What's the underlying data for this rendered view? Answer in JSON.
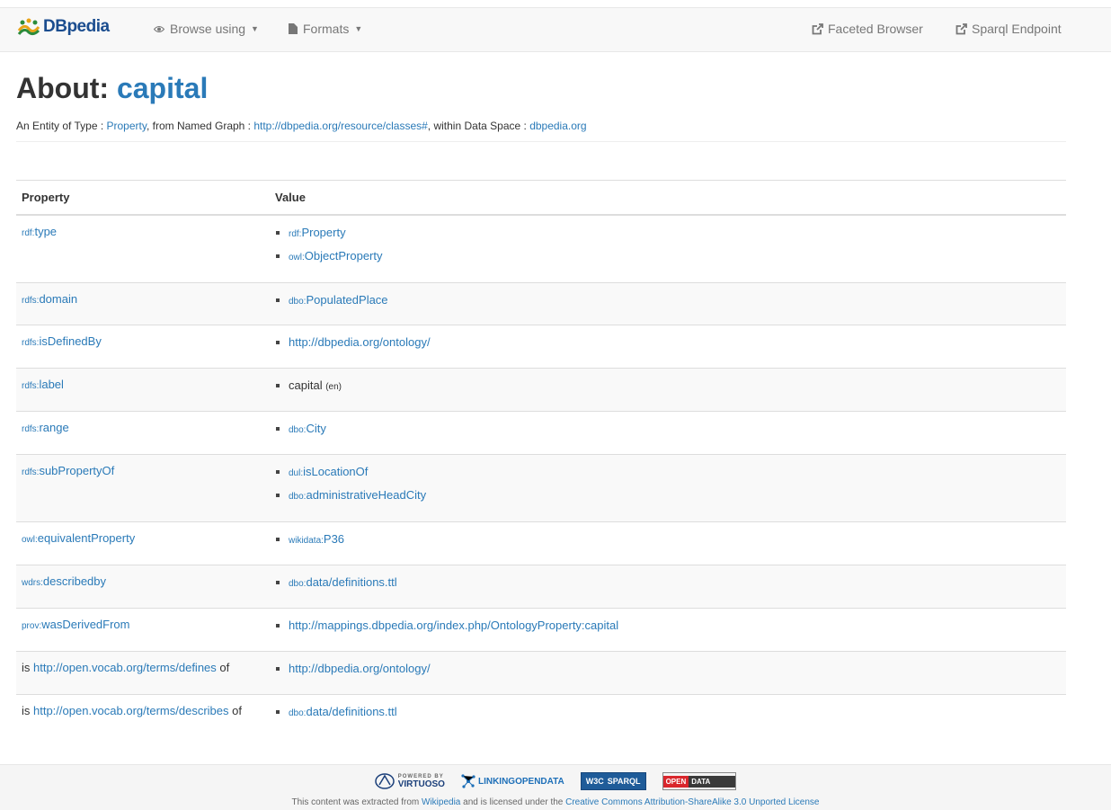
{
  "navbar": {
    "brand": "DBpedia",
    "browse_using": "Browse using",
    "formats": "Formats",
    "faceted_browser": "Faceted Browser",
    "sparql_endpoint": "Sparql Endpoint"
  },
  "page": {
    "about_label": "About:",
    "title": "capital",
    "subtitle": {
      "p1": "An Entity of Type : ",
      "type": "Property",
      "p2": ", from Named Graph : ",
      "graph": "http://dbpedia.org/resource/classes#",
      "p3": ", within Data Space : ",
      "space": "dbpedia.org"
    }
  },
  "table": {
    "header_property": "Property",
    "header_value": "Value",
    "rows": [
      {
        "prefix": "rdf:",
        "name": "type",
        "values": [
          {
            "prefix": "rdf:",
            "text": "Property"
          },
          {
            "prefix": "owl:",
            "text": "ObjectProperty"
          }
        ]
      },
      {
        "prefix": "rdfs:",
        "name": "domain",
        "values": [
          {
            "prefix": "dbo:",
            "text": "PopulatedPlace"
          }
        ]
      },
      {
        "prefix": "rdfs:",
        "name": "isDefinedBy",
        "values": [
          {
            "text": "http://dbpedia.org/ontology/"
          }
        ]
      },
      {
        "prefix": "rdfs:",
        "name": "label",
        "values": [
          {
            "text": "capital",
            "lang": "(en)"
          }
        ]
      },
      {
        "prefix": "rdfs:",
        "name": "range",
        "values": [
          {
            "prefix": "dbo:",
            "text": "City"
          }
        ]
      },
      {
        "prefix": "rdfs:",
        "name": "subPropertyOf",
        "values": [
          {
            "prefix": "dul:",
            "text": "isLocationOf"
          },
          {
            "prefix": "dbo:",
            "text": "administrativeHeadCity"
          }
        ]
      },
      {
        "prefix": "owl:",
        "name": "equivalentProperty",
        "values": [
          {
            "prefix": "wikidata:",
            "text": "P36"
          }
        ]
      },
      {
        "prefix": "wdrs:",
        "name": "describedby",
        "values": [
          {
            "prefix": "dbo:",
            "text": "data/definitions.ttl"
          }
        ]
      },
      {
        "prefix": "prov:",
        "name": "wasDerivedFrom",
        "values": [
          {
            "text": "http://mappings.dbpedia.org/index.php/OntologyProperty:capital"
          }
        ]
      },
      {
        "is": "is ",
        "link": "http://open.vocab.org/terms/defines",
        "of": " of",
        "values": [
          {
            "text": "http://dbpedia.org/ontology/"
          }
        ]
      },
      {
        "is": "is ",
        "link": "http://open.vocab.org/terms/describes",
        "of": " of",
        "values": [
          {
            "prefix": "dbo:",
            "text": "data/definitions.ttl"
          }
        ]
      }
    ]
  },
  "footer": {
    "logo_virtuoso_small": "POWERED BY",
    "logo_virtuoso": "VIRTUOSO",
    "logo_lod": "LINKINGOPENDATA",
    "logo_w3c": "W3C",
    "logo_sparql": "SPARQL",
    "logo_open": "OPEN",
    "logo_data": "DATA",
    "t1": "This content was extracted from ",
    "wikipedia": "Wikipedia",
    "t2": " and is licensed under the ",
    "license": "Creative Commons Attribution-ShareAlike 3.0 Unported License"
  }
}
